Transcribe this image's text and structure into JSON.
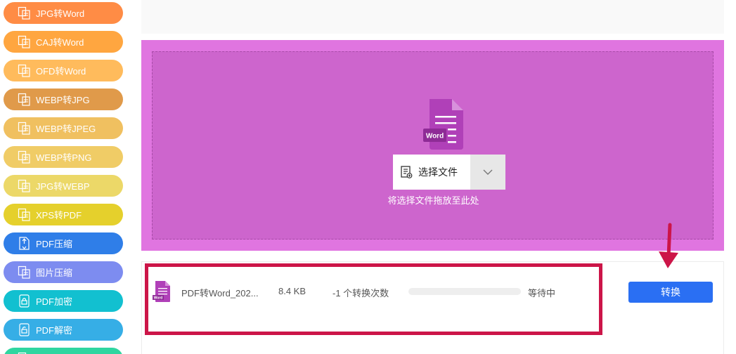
{
  "sidebar": {
    "items": [
      {
        "label": "JPG转Word",
        "color": "#ff8c45",
        "icon": "image-doc-icon"
      },
      {
        "label": "CAJ转Word",
        "color": "#ffa640",
        "icon": "caj-doc-icon"
      },
      {
        "label": "OFD转Word",
        "color": "#ffbb5c",
        "icon": "ofd-doc-icon"
      },
      {
        "label": "WEBP转JPG",
        "color": "#e09a4a",
        "icon": "image-convert-icon"
      },
      {
        "label": "WEBP转JPEG",
        "color": "#f0c060",
        "icon": "image-convert-icon"
      },
      {
        "label": "WEBP转PNG",
        "color": "#f0cc66",
        "icon": "image-convert-icon"
      },
      {
        "label": "JPG转WEBP",
        "color": "#ecd868",
        "icon": "image-convert-icon"
      },
      {
        "label": "XPS转PDF",
        "color": "#e5d02c",
        "icon": "xps-doc-icon"
      },
      {
        "label": "PDF压缩",
        "color": "#2f7ee8",
        "icon": "compress-icon"
      },
      {
        "label": "图片压缩",
        "color": "#7d8cf0",
        "icon": "image-compress-icon"
      },
      {
        "label": "PDF加密",
        "color": "#12c0d0",
        "icon": "lock-icon"
      },
      {
        "label": "PDF解密",
        "color": "#36aee6",
        "icon": "unlock-icon"
      },
      {
        "label": "",
        "color": "#2fd6a0",
        "icon": "doc-icon"
      }
    ]
  },
  "upload": {
    "doc_badge": "Word",
    "select_label": "选择文件",
    "drop_hint": "将选择文件拖放至此处"
  },
  "file": {
    "name": "PDF转Word_202...",
    "size": "8.4 KB",
    "conversions": "-1 个转换次数",
    "progress": 0,
    "status": "等待中",
    "icon_badge": "Word"
  },
  "actions": {
    "convert_label": "转换"
  },
  "colors": {
    "dropzone": "#e075e0",
    "dropzone_inner": "#cd65cd",
    "primary": "#2a6ff3",
    "highlight": "#cc1548",
    "word_icon": "#b040b8"
  }
}
